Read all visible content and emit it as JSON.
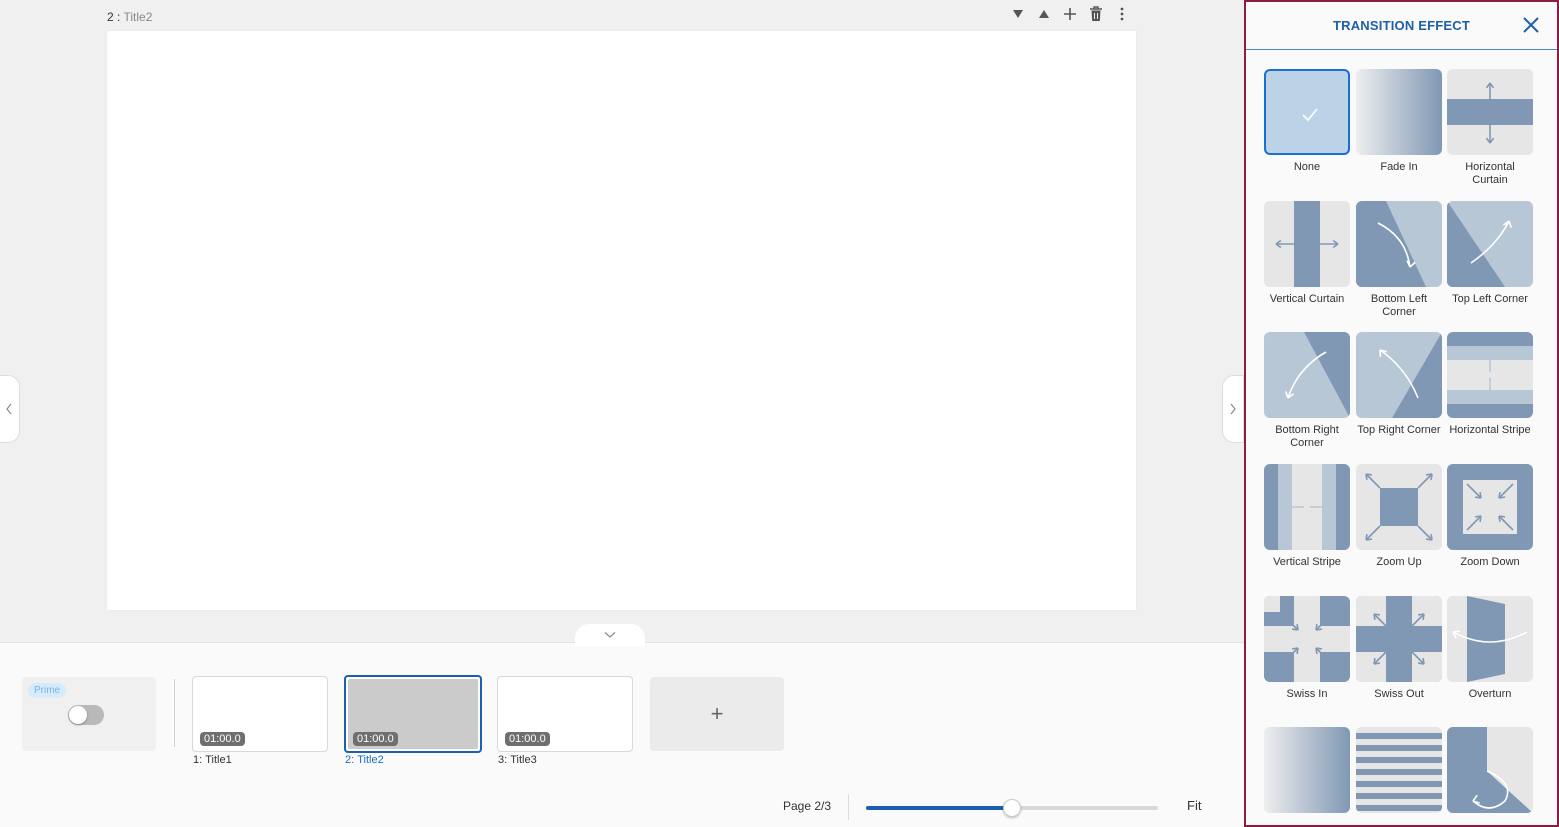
{
  "editor": {
    "slide_number": "2",
    "slide_title": "Title2",
    "toolbar": {
      "move_down": "move-down-icon",
      "move_up": "move-up-icon",
      "add": "plus-icon",
      "delete": "trash-icon",
      "more": "more-vertical-icon"
    }
  },
  "filmstrip": {
    "prime_label": "Prime",
    "prime_enabled": false,
    "slides": [
      {
        "index": "1",
        "title": "Title1",
        "duration": "01:00.0",
        "selected": false
      },
      {
        "index": "2",
        "title": "Title2",
        "duration": "01:00.0",
        "selected": true
      },
      {
        "index": "3",
        "title": "Title3",
        "duration": "01:00.0",
        "selected": false
      }
    ],
    "add_label": "+"
  },
  "footer": {
    "page_indicator": "Page 2/3",
    "zoom_fraction": 0.5,
    "fit_label": "Fit"
  },
  "panel": {
    "title": "TRANSITION EFFECT",
    "effects": [
      {
        "id": "none",
        "label": "None",
        "selected": true
      },
      {
        "id": "fade-in",
        "label": "Fade In"
      },
      {
        "id": "horizontal-curtain",
        "label": "Horizontal Curtain"
      },
      {
        "id": "vertical-curtain",
        "label": "Vertical Curtain"
      },
      {
        "id": "bottom-left-corner",
        "label": "Bottom Left Corner"
      },
      {
        "id": "top-left-corner",
        "label": "Top Left Corner"
      },
      {
        "id": "bottom-right-corner",
        "label": "Bottom Right Corner"
      },
      {
        "id": "top-right-corner",
        "label": "Top Right Corner"
      },
      {
        "id": "horizontal-stripe",
        "label": "Horizontal Stripe"
      },
      {
        "id": "vertical-stripe",
        "label": "Vertical Stripe"
      },
      {
        "id": "zoom-up",
        "label": "Zoom Up"
      },
      {
        "id": "zoom-down",
        "label": "Zoom Down"
      },
      {
        "id": "swiss-in",
        "label": "Swiss In"
      },
      {
        "id": "swiss-out",
        "label": "Swiss Out"
      },
      {
        "id": "overturn",
        "label": "Overturn"
      },
      {
        "id": "dissolve",
        "label": ""
      },
      {
        "id": "blinds",
        "label": ""
      },
      {
        "id": "turn",
        "label": ""
      }
    ]
  },
  "colors": {
    "accent": "#1a5fb4",
    "panel_border": "#8b1d44",
    "tile_dark": "#8098b4",
    "tile_light": "#b8c7d6",
    "tile_bg": "#e6e6e6"
  }
}
